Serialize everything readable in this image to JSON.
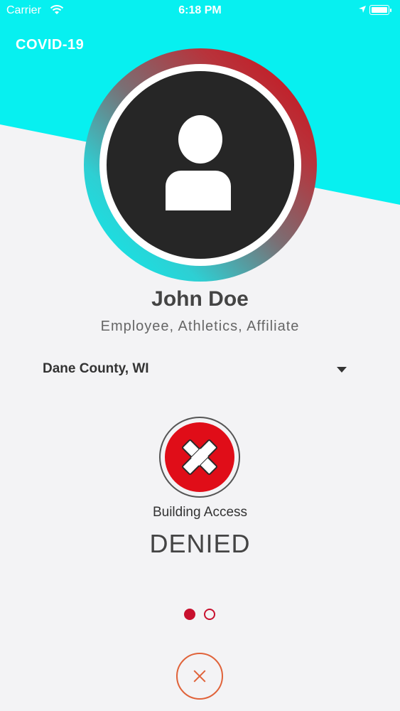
{
  "status_bar": {
    "carrier": "Carrier",
    "time": "6:18 PM",
    "wifi_icon": "wifi-icon",
    "location_icon": "location-arrow-icon",
    "battery_icon": "battery-icon"
  },
  "header": {
    "brand": "COVID-19"
  },
  "profile": {
    "avatar_icon": "person-icon",
    "name": "John Doe",
    "roles": "Employee, Athletics, Affiliate"
  },
  "location_select": {
    "selected": "Dane County, WI",
    "caret_icon": "caret-down-icon"
  },
  "access": {
    "status_icon": "x-circle-icon",
    "label": "Building Access",
    "status": "DENIED",
    "status_color": "#e00d18"
  },
  "pagination": {
    "total": 2,
    "current": 1
  },
  "footer": {
    "close_icon": "close-icon"
  },
  "colors": {
    "accent_cyan": "#07f0f0",
    "brand_red": "#c8102e",
    "close_orange": "#e0633a"
  }
}
